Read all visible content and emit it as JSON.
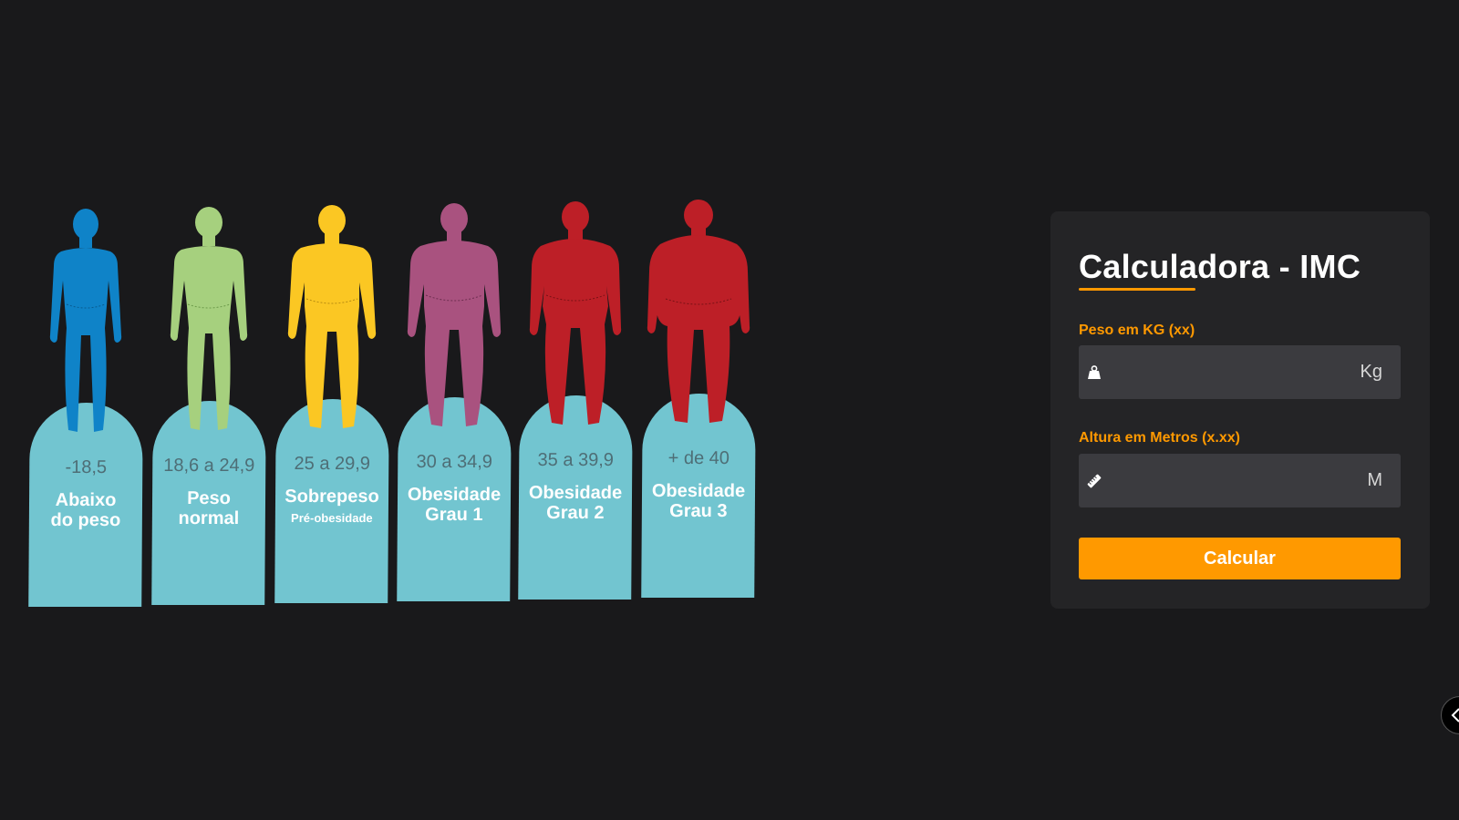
{
  "bmi_chart": {
    "categories": [
      {
        "range": "-18,5",
        "label_line1": "Abaixo",
        "label_line2": "do peso",
        "sublabel": "",
        "color": "#0f83c8",
        "figure": "slim"
      },
      {
        "range": "18,6 a 24,9",
        "label_line1": "Peso",
        "label_line2": "normal",
        "sublabel": "",
        "color": "#a6d07e",
        "figure": "normal"
      },
      {
        "range": "25 a 29,9",
        "label_line1": "Sobrepeso",
        "label_line2": "",
        "sublabel": "Pré-obesidade",
        "color": "#fbc723",
        "figure": "overweight"
      },
      {
        "range": "30 a 34,9",
        "label_line1": "Obesidade",
        "label_line2": "Grau 1",
        "sublabel": "",
        "color": "#a9527f",
        "figure": "obese1"
      },
      {
        "range": "35 a 39,9",
        "label_line1": "Obesidade",
        "label_line2": "Grau 2",
        "sublabel": "",
        "color": "#bd1f27",
        "figure": "obese2"
      },
      {
        "range": "+ de 40",
        "label_line1": "Obesidade",
        "label_line2": "Grau 3",
        "sublabel": "",
        "color": "#bd1f27",
        "figure": "obese3"
      }
    ]
  },
  "calculator": {
    "title": "Calculadora - IMC",
    "weight": {
      "label": "Peso em KG (xx)",
      "value": "",
      "placeholder": "",
      "unit": "Kg",
      "icon": "weight-icon"
    },
    "height": {
      "label": "Altura em Metros (x.xx)",
      "value": "",
      "placeholder": "",
      "unit": "M",
      "icon": "ruler-icon"
    },
    "button_label": "Calcular",
    "accent_color": "#ff9900"
  },
  "side_toggle": {
    "icon": "chevron-left-icon"
  }
}
